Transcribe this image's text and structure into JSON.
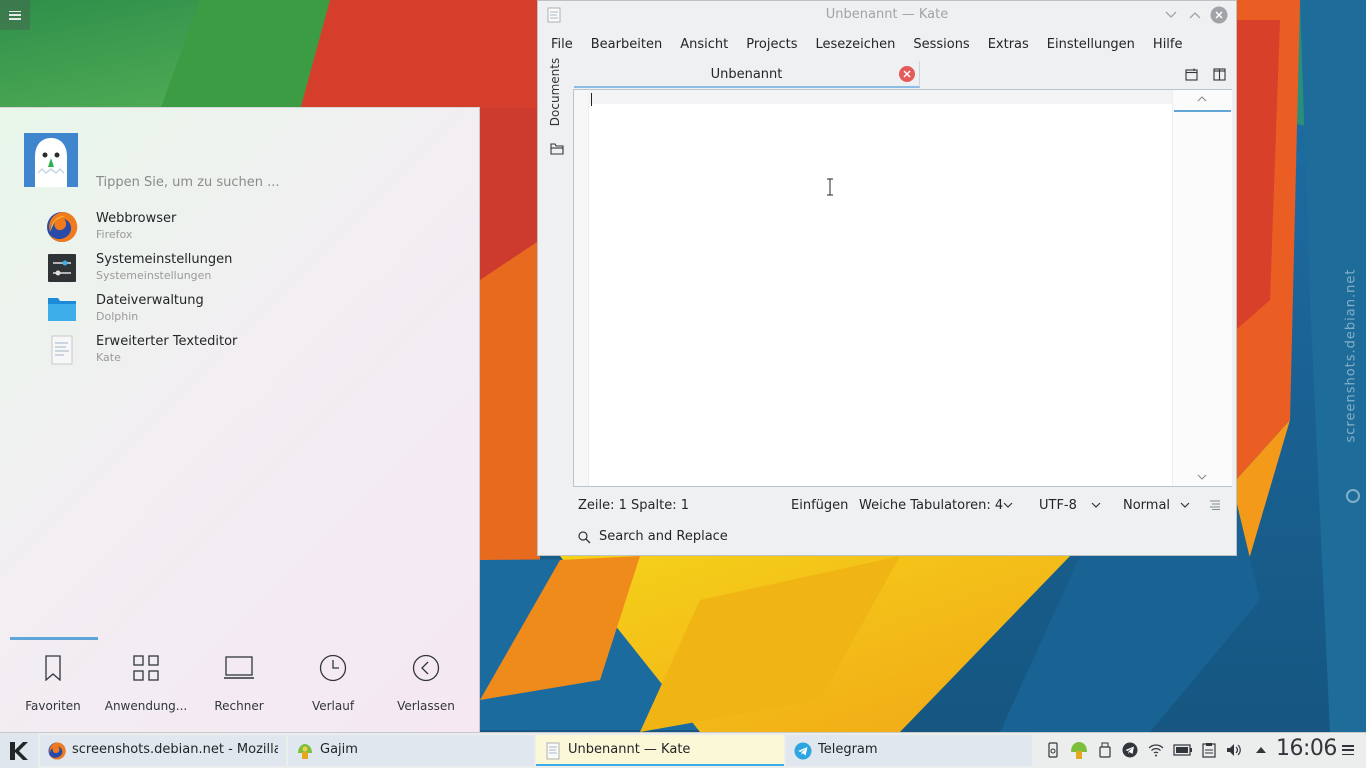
{
  "desktop": {
    "watermark": "screenshots.debian.net"
  },
  "launcher": {
    "search_placeholder": "Tippen Sie, um zu suchen ...",
    "favorites": [
      {
        "name": "Webbrowser",
        "sub": "Firefox",
        "icon": "firefox-icon"
      },
      {
        "name": "Systemeinstellungen",
        "sub": "Systemeinstellungen",
        "icon": "system-settings-icon"
      },
      {
        "name": "Dateiverwaltung",
        "sub": "Dolphin",
        "icon": "folder-icon"
      },
      {
        "name": "Erweiterter Texteditor",
        "sub": "Kate",
        "icon": "text-editor-icon"
      }
    ],
    "tabs": [
      {
        "label": "Favoriten",
        "icon": "bookmark-icon"
      },
      {
        "label": "Anwendung...",
        "icon": "grid-icon"
      },
      {
        "label": "Rechner",
        "icon": "computer-icon"
      },
      {
        "label": "Verlauf",
        "icon": "clock-icon"
      },
      {
        "label": "Verlassen",
        "icon": "leave-icon"
      }
    ],
    "active_tab": "Favoriten"
  },
  "kate": {
    "title": "Unbenannt — Kate",
    "menu": [
      "File",
      "Bearbeiten",
      "Ansicht",
      "Projects",
      "Lesezeichen",
      "Sessions",
      "Extras",
      "Einstellungen",
      "Hilfe"
    ],
    "side_panel": "Documents",
    "doc_tab": "Unbenannt",
    "status": {
      "position": "Zeile: 1 Spalte: 1",
      "mode": "Einfügen",
      "indent": "Weiche Tabulatoren: 4",
      "encoding": "UTF-8",
      "syntax": "Normal"
    },
    "search_replace": "Search and Replace"
  },
  "taskbar": {
    "tasks": [
      {
        "label": "screenshots.debian.net - Mozilla ...",
        "icon": "firefox-icon"
      },
      {
        "label": "Gajim",
        "icon": "gajim-icon"
      },
      {
        "label": "Unbenannt  — Kate",
        "icon": "text-editor-icon"
      },
      {
        "label": "Telegram",
        "icon": "telegram-icon"
      }
    ],
    "active_task": "Unbenannt  — Kate",
    "clock": "16:06"
  }
}
